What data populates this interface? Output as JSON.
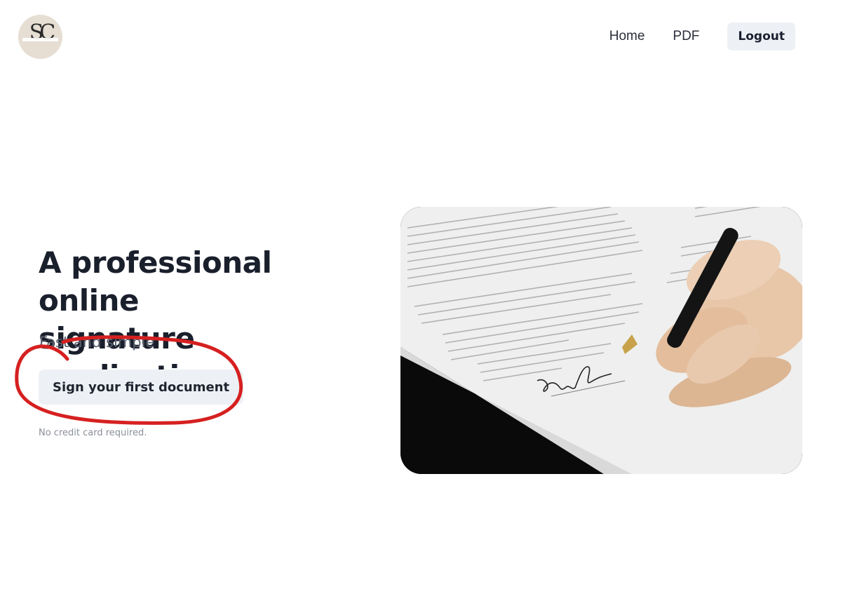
{
  "brand": {
    "monogram": "SC"
  },
  "nav": {
    "items": [
      "Home",
      "PDF"
    ],
    "logout_label": "Logout"
  },
  "hero": {
    "title_line1": "A professional online",
    "title_line2": "signature application",
    "subtitle": "Fast and simple",
    "cta_label": "Sign your first document",
    "note": "No credit card required."
  },
  "colors": {
    "button_bg": "#edf1f5",
    "annotation": "#d62020",
    "logo_bg": "#e6ded3"
  },
  "icons": [
    "logo-monogram"
  ]
}
